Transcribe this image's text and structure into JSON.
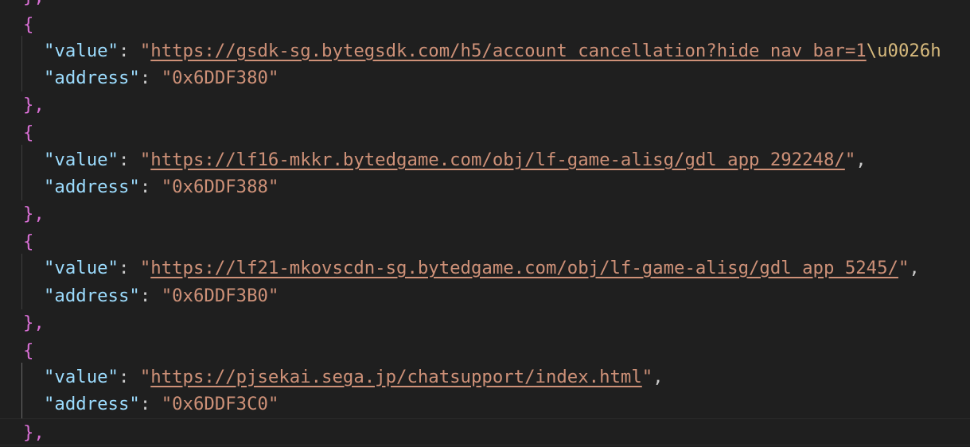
{
  "editor": {
    "top_fragment": "},",
    "entries": [
      {
        "open": "{",
        "value_key": "\"value\"",
        "value_url": "https://gsdk-sg.bytegsdk.com/h5/account_cancellation?hide_nav_bar=1",
        "value_escape": "\\u0026h",
        "value_tail": "",
        "address_key": "\"address\"",
        "address": "0x6DDF380",
        "close": "},"
      },
      {
        "open": "{",
        "value_key": "\"value\"",
        "value_url": "https://lf16-mkkr.bytedgame.com/obj/lf-game-alisg/gdl_app_292248/",
        "value_escape": "",
        "value_tail": ",",
        "address_key": "\"address\"",
        "address": "0x6DDF388",
        "close": "},"
      },
      {
        "open": "{",
        "value_key": "\"value\"",
        "value_url": "https://lf21-mkovscdn-sg.bytedgame.com/obj/lf-game-alisg/gdl_app_5245/",
        "value_escape": "",
        "value_tail": ",",
        "address_key": "\"address\"",
        "address": "0x6DDF3B0",
        "close": "},"
      },
      {
        "open": "{",
        "value_key": "\"value\"",
        "value_url": "https://pjsekai.sega.jp/chatsupport/index.html",
        "value_escape": "",
        "value_tail": ",",
        "address_key": "\"address\"",
        "address": "0x6DDF3C0",
        "close": "},"
      }
    ]
  },
  "colors": {
    "background": "#1f1f1f",
    "brace": "#da70d6",
    "key": "#9cdcfe",
    "string": "#ce9178",
    "escape": "#d7ba7d",
    "punctuation": "#cccccc"
  }
}
